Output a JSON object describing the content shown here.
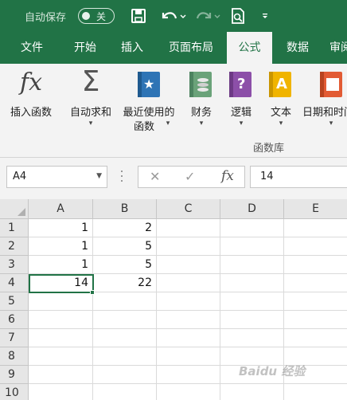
{
  "titlebar": {
    "autosave_label": "自动保存",
    "toggle_state": "关",
    "icons": [
      "save-icon",
      "undo-icon",
      "redo-icon",
      "print-preview-icon",
      "customize-quick-access-icon"
    ],
    "bg_color": "#217346"
  },
  "tabs": [
    {
      "label": "文件",
      "active": false
    },
    {
      "label": "开始",
      "active": false
    },
    {
      "label": "插入",
      "active": false
    },
    {
      "label": "页面布局",
      "active": false
    },
    {
      "label": "公式",
      "active": true
    },
    {
      "label": "数据",
      "active": false
    },
    {
      "label": "审阅",
      "active": false
    }
  ],
  "ribbon": {
    "insert_function": {
      "icon": "fx",
      "label": "插入函数"
    },
    "autosum": {
      "icon": "Σ",
      "label": "自动求和"
    },
    "recent": {
      "label_line1": "最近使用的",
      "label_line2": "函数"
    },
    "financial": {
      "label": "财务"
    },
    "logical": {
      "label": "逻辑",
      "glyph": "?"
    },
    "text": {
      "label": "文本",
      "glyph": "A"
    },
    "datetime": {
      "label": "日期和时间"
    },
    "group_label": "函数库"
  },
  "formula_bar": {
    "name_box": "A4",
    "cancel_glyph": "✕",
    "enter_glyph": "✓",
    "fx_glyph": "fx",
    "value": "14"
  },
  "sheet": {
    "columns": [
      "A",
      "B",
      "C",
      "D",
      "E"
    ],
    "rows": [
      "1",
      "2",
      "3",
      "4",
      "5",
      "6",
      "7",
      "8",
      "9",
      "10"
    ],
    "cells": [
      [
        "1",
        "2",
        "",
        "",
        ""
      ],
      [
        "1",
        "5",
        "",
        "",
        ""
      ],
      [
        "1",
        "5",
        "",
        "",
        ""
      ],
      [
        "14",
        "22",
        "",
        "",
        ""
      ],
      [
        "",
        "",
        "",
        "",
        ""
      ],
      [
        "",
        "",
        "",
        "",
        ""
      ],
      [
        "",
        "",
        "",
        "",
        ""
      ],
      [
        "",
        "",
        "",
        "",
        ""
      ],
      [
        "",
        "",
        "",
        "",
        ""
      ],
      [
        "",
        "",
        "",
        "",
        ""
      ]
    ]
  },
  "watermark": "Baidu 经验"
}
